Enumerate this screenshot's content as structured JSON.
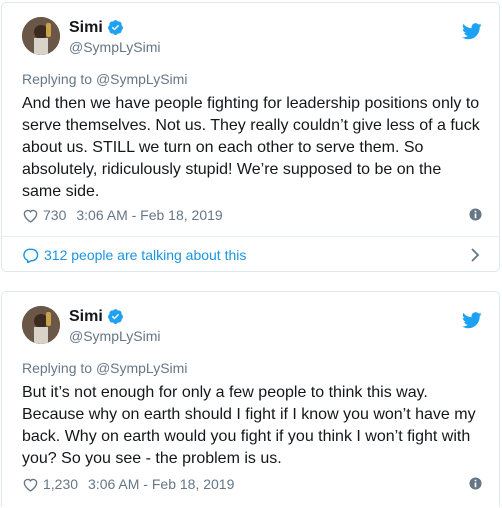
{
  "tweets": [
    {
      "name": "Simi",
      "handle": "@SympLySimi",
      "replying_prefix": "Replying to ",
      "replying_handle": "@SympLySimi",
      "text": "And then we have people fighting for leadership positions only to\nserve themselves. Not us. They really couldn’t give less of a fuck\nabout us. STILL we turn on each other to serve them. So\nabsolutely, ridiculously stupid! We’re supposed to be on the\nsame side.",
      "likes": "730",
      "timestamp": "3:06 AM - Feb 18, 2019",
      "talking": "312 people are talking about this"
    },
    {
      "name": "Simi",
      "handle": "@SympLySimi",
      "replying_prefix": "Replying to ",
      "replying_handle": "@SympLySimi",
      "text": "But it’s not enough for only a few people to think this way.\nBecause why on earth should I fight if I know you won’t have my\nback. Why on earth would you fight if you think I won’t fight with\nyou? So you see - the problem is us.",
      "likes": "1,230",
      "timestamp": "3:06 AM - Feb 18, 2019"
    }
  ],
  "colors": {
    "text": "#14171a",
    "muted": "#657786",
    "accent": "#1b95e0",
    "twitter_blue": "#1da1f2",
    "border": "#e1e8ed"
  },
  "icons": {
    "verified": "verified-badge-icon",
    "bird": "twitter-bird-icon",
    "like": "heart-icon",
    "info": "info-icon",
    "conversation": "speech-bubble-icon",
    "chevron": "chevron-right-icon"
  }
}
